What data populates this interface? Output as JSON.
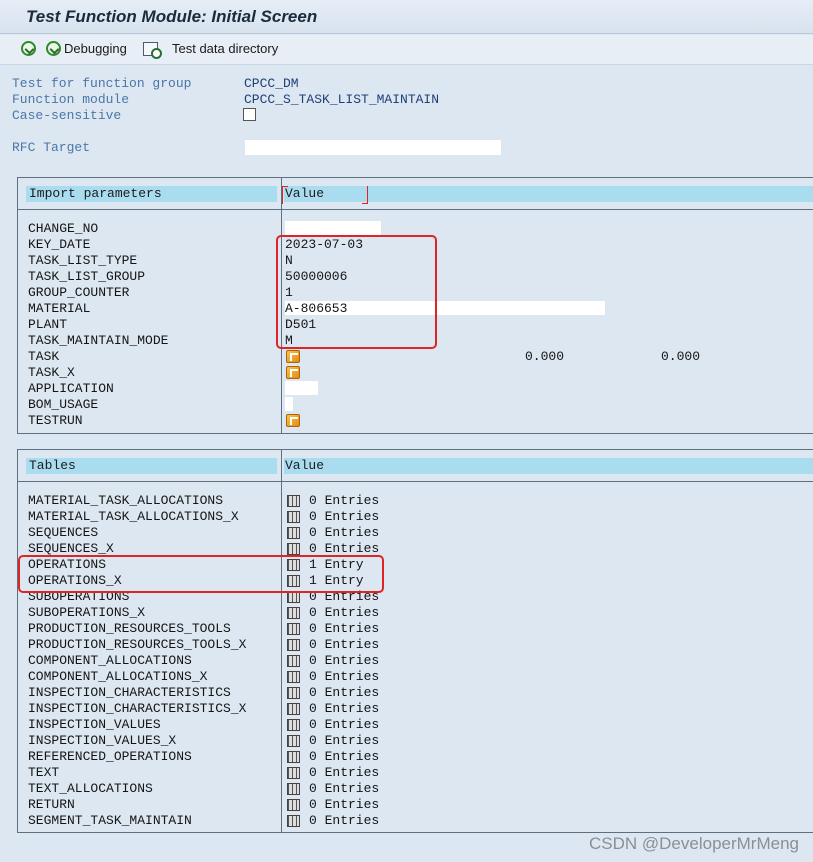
{
  "window": {
    "title": "Test Function Module: Initial Screen"
  },
  "toolbar": {
    "debugging_label": "Debugging",
    "test_data_label": "Test data directory"
  },
  "header": {
    "function_group_label": "Test for function group",
    "function_group_value": "CPCC_DM",
    "function_module_label": "Function module",
    "function_module_value": "CPCC_S_TASK_LIST_MAINTAIN",
    "case_sensitive_label": "Case-sensitive",
    "rfc_target_label": "RFC Target"
  },
  "import": {
    "header_label": "Import parameters",
    "value_label": "Value",
    "rows": [
      {
        "name": "CHANGE_NO",
        "value": ""
      },
      {
        "name": "KEY_DATE",
        "value": "2023-07-03"
      },
      {
        "name": "TASK_LIST_TYPE",
        "value": "N"
      },
      {
        "name": "TASK_LIST_GROUP",
        "value": "50000006"
      },
      {
        "name": "GROUP_COUNTER",
        "value": "1"
      },
      {
        "name": "MATERIAL",
        "value": "A-806653"
      },
      {
        "name": "PLANT",
        "value": "D501"
      },
      {
        "name": "TASK_MAINTAIN_MODE",
        "value": "M"
      },
      {
        "name": "TASK",
        "value": "",
        "num1": "0.000",
        "num2": "0.000"
      },
      {
        "name": "TASK_X",
        "value": ""
      },
      {
        "name": "APPLICATION",
        "value": ""
      },
      {
        "name": "BOM_USAGE",
        "value": ""
      },
      {
        "name": "TESTRUN",
        "value": ""
      }
    ]
  },
  "tables": {
    "header_label": "Tables",
    "value_label": "Value",
    "rows": [
      {
        "name": "MATERIAL_TASK_ALLOCATIONS",
        "value": "0 Entries"
      },
      {
        "name": "MATERIAL_TASK_ALLOCATIONS_X",
        "value": "0 Entries"
      },
      {
        "name": "SEQUENCES",
        "value": "0 Entries"
      },
      {
        "name": "SEQUENCES_X",
        "value": "0 Entries"
      },
      {
        "name": "OPERATIONS",
        "value": "1 Entry"
      },
      {
        "name": "OPERATIONS_X",
        "value": "1 Entry"
      },
      {
        "name": "SUBOPERATIONS",
        "value": "0 Entries"
      },
      {
        "name": "SUBOPERATIONS_X",
        "value": "0 Entries"
      },
      {
        "name": "PRODUCTION_RESOURCES_TOOLS",
        "value": "0 Entries"
      },
      {
        "name": "PRODUCTION_RESOURCES_TOOLS_X",
        "value": "0 Entries"
      },
      {
        "name": "COMPONENT_ALLOCATIONS",
        "value": "0 Entries"
      },
      {
        "name": "COMPONENT_ALLOCATIONS_X",
        "value": "0 Entries"
      },
      {
        "name": "INSPECTION_CHARACTERISTICS",
        "value": "0 Entries"
      },
      {
        "name": "INSPECTION_CHARACTERISTICS_X",
        "value": "0 Entries"
      },
      {
        "name": "INSPECTION_VALUES",
        "value": "0 Entries"
      },
      {
        "name": "INSPECTION_VALUES_X",
        "value": "0 Entries"
      },
      {
        "name": "REFERENCED_OPERATIONS",
        "value": "0 Entries"
      },
      {
        "name": "TEXT",
        "value": "0 Entries"
      },
      {
        "name": "TEXT_ALLOCATIONS",
        "value": "0 Entries"
      },
      {
        "name": "RETURN",
        "value": "0 Entries"
      },
      {
        "name": "SEGMENT_TASK_MAINTAIN",
        "value": "0 Entries"
      }
    ]
  },
  "watermark": "CSDN @DeveloperMrMeng"
}
